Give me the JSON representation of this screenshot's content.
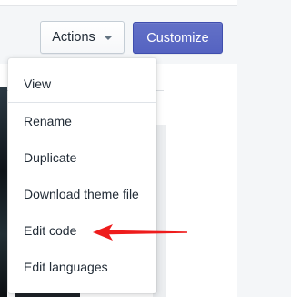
{
  "header": {
    "actions_label": "Actions",
    "customize_label": "Customize"
  },
  "menu": {
    "items": [
      {
        "label": "View"
      },
      {
        "label": "Rename"
      },
      {
        "label": "Duplicate"
      },
      {
        "label": "Download theme file"
      },
      {
        "label": "Edit code"
      },
      {
        "label": "Edit languages"
      }
    ]
  },
  "colors": {
    "primary": "#5c6ac4",
    "annotation_arrow": "#ee1c1c",
    "text": "#212b36"
  }
}
